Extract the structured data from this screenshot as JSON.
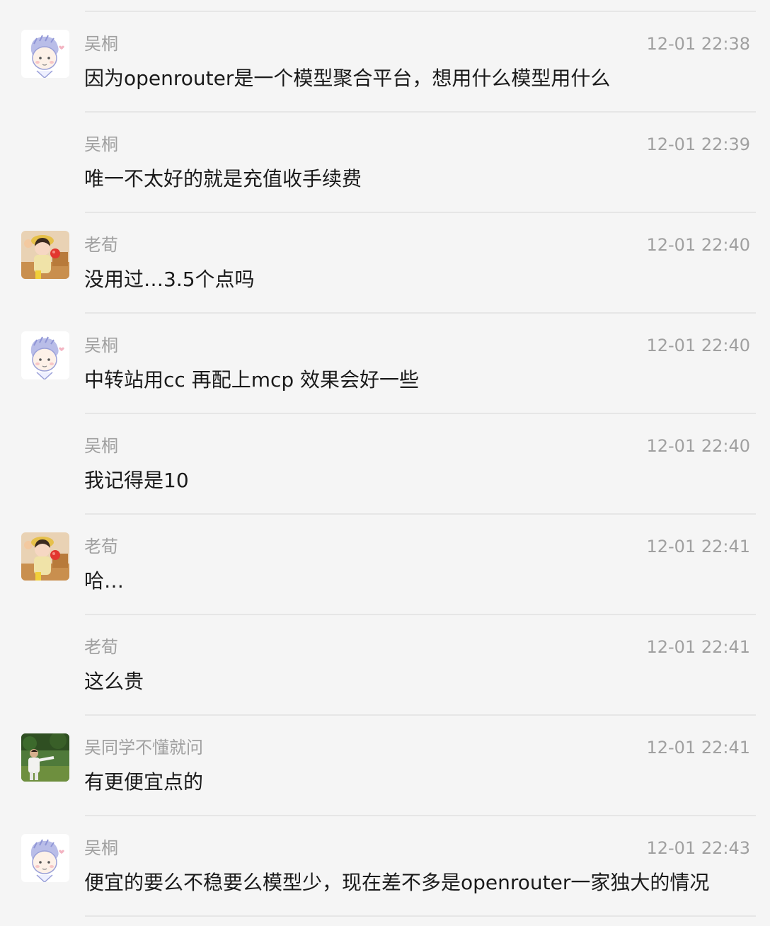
{
  "messages": [
    {
      "sender": "吴桐",
      "time": "12-01 22:38",
      "text": "因为openrouter是一个模型聚合平台，想用什么模型用什么",
      "avatar": "cartoon-boy-avatar"
    },
    {
      "sender": "吴桐",
      "time": "12-01 22:39",
      "text": "唯一不太好的就是充值收手续费",
      "avatar": ""
    },
    {
      "sender": "老荀",
      "time": "12-01 22:40",
      "text": "没用过…3.5个点吗",
      "avatar": "girl-photo-avatar"
    },
    {
      "sender": "吴桐",
      "time": "12-01 22:40",
      "text": "中转站用cc 再配上mcp 效果会好一些",
      "avatar": "cartoon-boy-avatar"
    },
    {
      "sender": "吴桐",
      "time": "12-01 22:40",
      "text": "我记得是10",
      "avatar": ""
    },
    {
      "sender": "老荀",
      "time": "12-01 22:41",
      "text": "哈…",
      "avatar": "girl-photo-avatar"
    },
    {
      "sender": "老荀",
      "time": "12-01 22:41",
      "text": "这么贵",
      "avatar": ""
    },
    {
      "sender": "吴同学不懂就问",
      "time": "12-01 22:41",
      "text": "有更便宜点的",
      "avatar": "outdoor-photo-avatar"
    },
    {
      "sender": "吴桐",
      "time": "12-01 22:43",
      "text": "便宜的要么不稳要么模型少，现在差不多是openrouter一家独大的情况",
      "avatar": "cartoon-boy-avatar"
    }
  ]
}
